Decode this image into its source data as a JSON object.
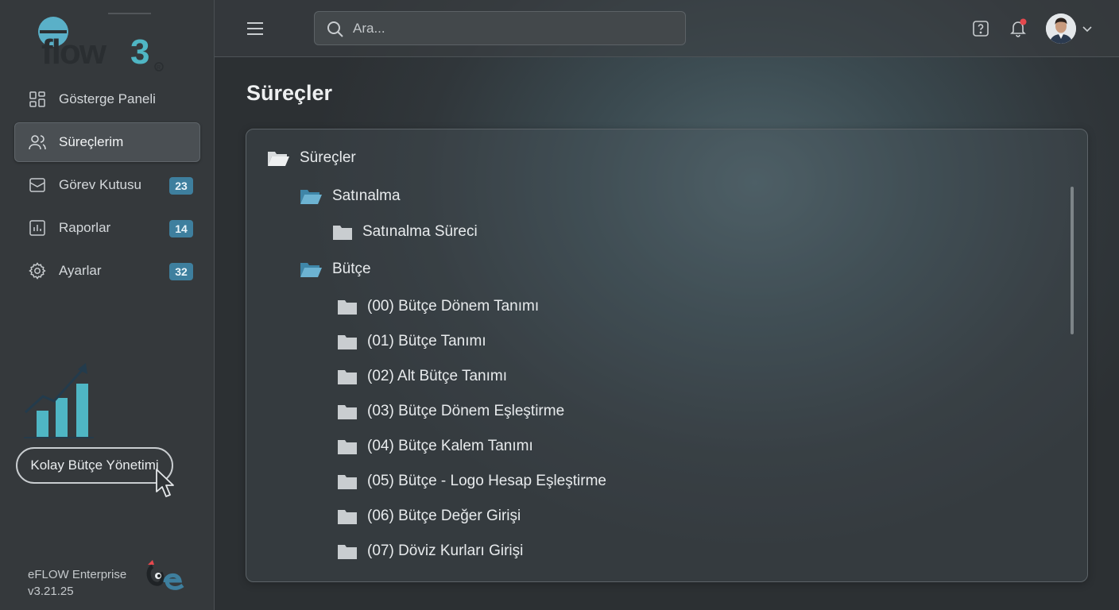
{
  "app": {
    "logo_text": "eflow3",
    "version_name": "eFLOW Enterprise",
    "version_number": "v3.21.25"
  },
  "sidebar": {
    "items": [
      {
        "label": "Gösterge Paneli",
        "icon": "dashboard-grid-icon",
        "badge": ""
      },
      {
        "label": "Süreçlerim",
        "icon": "users-icon",
        "badge": "",
        "active": true
      },
      {
        "label": "Görev Kutusu",
        "icon": "inbox-icon",
        "badge": "23"
      },
      {
        "label": "Raporlar",
        "icon": "report-chart-icon",
        "badge": "14"
      },
      {
        "label": "Ayarlar",
        "icon": "gear-icon",
        "badge": "32"
      }
    ],
    "promo_label": "Kolay Bütçe Yönetimi"
  },
  "topbar": {
    "search_placeholder": "Ara...",
    "notification_dot_color": "#e5484d"
  },
  "main": {
    "page_title": "Süreçler",
    "tree": {
      "root": "Süreçler",
      "groups": [
        {
          "label": "Satınalma",
          "children": [
            "Satınalma Süreci"
          ]
        },
        {
          "label": "Bütçe",
          "children": [
            "(00) Bütçe Dönem Tanımı",
            "(01) Bütçe Tanımı",
            "(02) Alt Bütçe Tanımı",
            "(03) Bütçe Dönem Eşleştirme",
            "(04) Bütçe Kalem Tanımı",
            "(05) Bütçe - Logo Hesap Eşleştirme",
            "(06) Bütçe Değer Girişi",
            "(07) Döviz Kurları Girişi"
          ]
        }
      ]
    }
  },
  "colors": {
    "accent": "#3e7f9e",
    "folder_open": "#5ca3c4",
    "folder_closed": "#c9cdd0",
    "chart_teal": "#4fb6c4"
  }
}
